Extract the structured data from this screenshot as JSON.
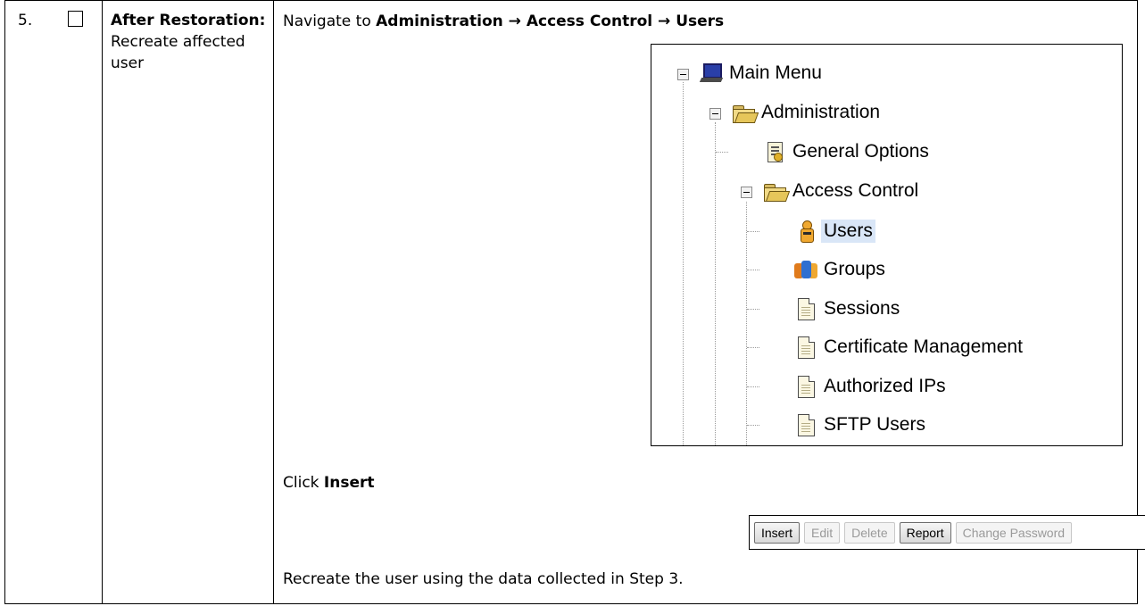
{
  "step": {
    "number": "5.",
    "title_bold": "After Restoration:",
    "title_text": "Recreate affected user"
  },
  "instructions": {
    "nav_prefix": "Navigate to ",
    "nav_path": "Administration → Access Control → Users",
    "click_prefix": "Click ",
    "click_target": "Insert",
    "final": "Recreate the user using the data collected in Step 3."
  },
  "tree": {
    "main_menu": {
      "label": "Main Menu",
      "icon": "monitor-icon"
    },
    "administration": {
      "label": "Administration",
      "icon": "folder-open-icon"
    },
    "general_options": {
      "label": "General Options",
      "icon": "options-page-icon"
    },
    "access_control": {
      "label": "Access Control",
      "icon": "folder-open-icon"
    },
    "users": {
      "label": "Users",
      "icon": "user-icon",
      "selected": true
    },
    "groups": {
      "label": "Groups",
      "icon": "group-icon"
    },
    "sessions": {
      "label": "Sessions",
      "icon": "page-icon"
    },
    "certificate_management": {
      "label": "Certificate Management",
      "icon": "page-icon"
    },
    "authorized_ips": {
      "label": "Authorized IPs",
      "icon": "page-icon"
    },
    "sftp_users": {
      "label": "SFTP Users",
      "icon": "page-icon"
    }
  },
  "buttons": {
    "insert": {
      "label": "Insert",
      "enabled": true
    },
    "edit": {
      "label": "Edit",
      "enabled": false
    },
    "delete": {
      "label": "Delete",
      "enabled": false
    },
    "report": {
      "label": "Report",
      "enabled": true
    },
    "change_password": {
      "label": "Change Password",
      "enabled": false
    }
  },
  "colors": {
    "selection": "#d9e6f7",
    "border": "#000000"
  }
}
